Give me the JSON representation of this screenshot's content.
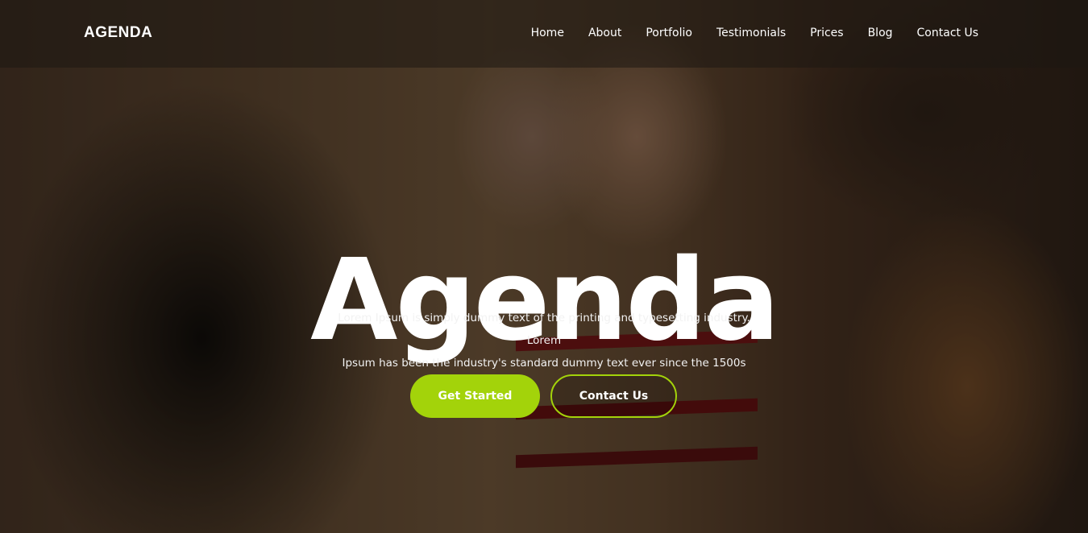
{
  "brand": {
    "logo": "AGENDA",
    "accent_color": "#a3d30a"
  },
  "nav": {
    "items": [
      {
        "label": "Home"
      },
      {
        "label": "About"
      },
      {
        "label": "Portfolio"
      },
      {
        "label": "Testimonials"
      },
      {
        "label": "Prices"
      },
      {
        "label": "Blog"
      },
      {
        "label": "Contact Us"
      }
    ]
  },
  "hero": {
    "title": "Agenda",
    "text_line1": "Lorem Ipsum is simply dummy text of the printing and typesetting industry. Lorem",
    "text_line2": "Ipsum has been the industry's standard dummy text ever since the 1500s",
    "primary_button": "Get Started",
    "secondary_button": "Contact Us"
  }
}
